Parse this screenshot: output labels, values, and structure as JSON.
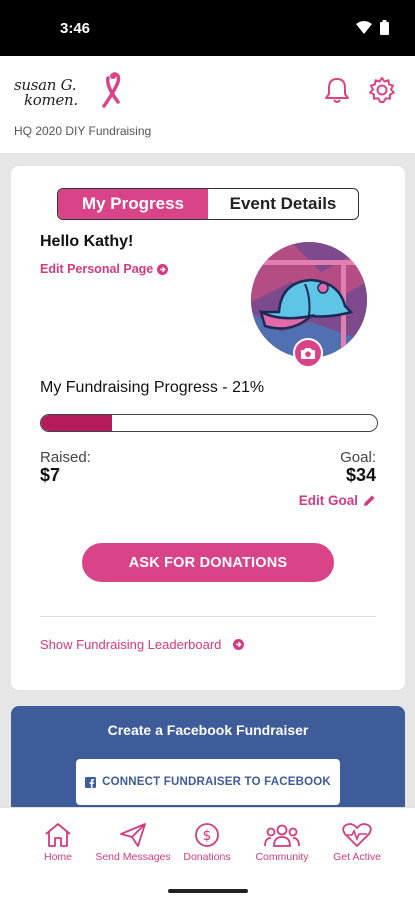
{
  "status_bar": {
    "time": "3:46"
  },
  "header": {
    "logo_line1": "susan G.",
    "logo_line2": "komen.",
    "subtitle": "HQ  2020 DIY Fundraising"
  },
  "tabs": {
    "active": "My Progress",
    "other": "Event Details"
  },
  "greeting": "Hello Kathy!",
  "edit_personal_page": "Edit Personal Page",
  "progress": {
    "title": "My Fundraising Progress - 21%",
    "percent": 21,
    "raised_label": "Raised:",
    "raised_value": "$7",
    "goal_label": "Goal:",
    "goal_value": "$34",
    "edit_goal": "Edit Goal"
  },
  "ask_button": "ASK FOR DONATIONS",
  "leaderboard_link": "Show Fundraising Leaderboard",
  "facebook": {
    "title": "Create a Facebook Fundraiser",
    "button": "CONNECT FUNDRAISER TO FACEBOOK"
  },
  "nav": {
    "home": "Home",
    "send_messages": "Send Messages",
    "donations": "Donations",
    "community": "Community",
    "get_active": "Get Active"
  },
  "colors": {
    "brand_pink": "#d94488",
    "progress_fill": "#b41b5a",
    "facebook_blue": "#3e5b9a"
  }
}
